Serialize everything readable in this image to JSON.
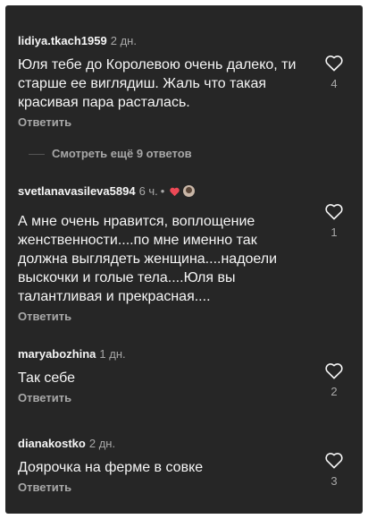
{
  "comments": [
    {
      "username": "lidiya.tkach1959",
      "time": "2 дн.",
      "text": "Юля тебе до Королевою очень далеко, ти старше ее виглядиш. Жаль что такая красивая пара расталась.",
      "reply_label": "Ответить",
      "likes": "4"
    },
    {
      "username": "svetlanavasileva5894",
      "time": "6 ч.",
      "separator": "•",
      "text": "А мне очень нравится, воплощение женственности....по мне именно так должна выглядеть женщина....надоели выскочки и голые тела....Юля вы талантливая и прекрасная....",
      "reply_label": "Ответить",
      "likes": "1"
    },
    {
      "username": "maryabozhina",
      "time": "1 дн.",
      "text": "Так себе",
      "reply_label": "Ответить",
      "likes": "2"
    },
    {
      "username": "dianakostko",
      "time": "2 дн.",
      "text": "Доярочка на ферме в совке",
      "reply_label": "Ответить",
      "likes": "3"
    }
  ],
  "view_more_replies": "Смотреть ещё 9 ответов",
  "colors": {
    "background": "#262626",
    "primary_text": "#f5f5f5",
    "secondary_text": "#a8a8a8",
    "liked_heart": "#ed4956"
  },
  "icons": [
    "heart-outline-icon",
    "heart-filled-icon",
    "author-avatar"
  ]
}
